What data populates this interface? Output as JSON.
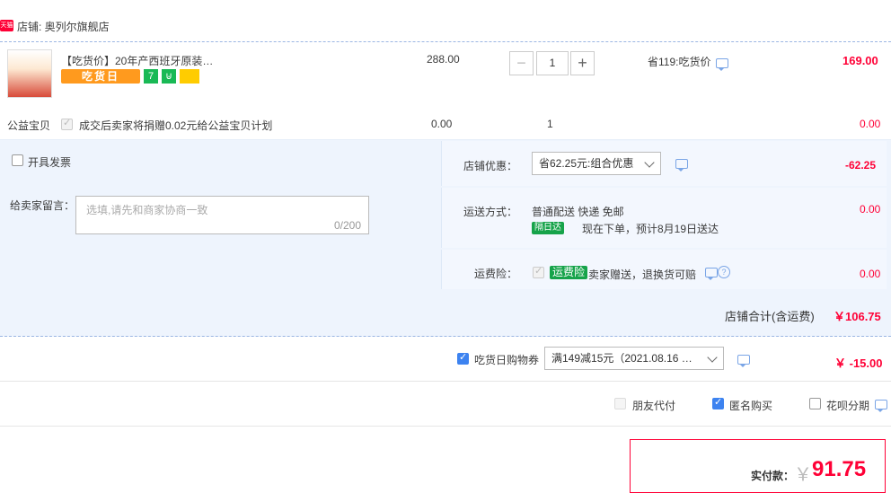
{
  "store": {
    "badge": "天猫",
    "label": "店铺: 奥列尔旗舰店"
  },
  "item": {
    "title": "【吃货价】20年产西班牙原装…",
    "tag_orange": "吃货日",
    "tag_green1": "7",
    "tag_green2": "⊍",
    "unit_price": "288.00",
    "qty_minus": "−",
    "quantity": "1",
    "qty_plus": "+",
    "promo": "省119:吃货价",
    "subtotal": "169.00"
  },
  "charity": {
    "label": "公益宝贝",
    "text": "成交后卖家将捐赠0.02元给公益宝贝计划",
    "price": "0.00",
    "qty": "1",
    "subtotal": "0.00"
  },
  "invoice": {
    "label": "开具发票"
  },
  "message": {
    "label": "给卖家留言：",
    "placeholder": "选填,请先和商家协商一致",
    "counter": "0/200"
  },
  "store_discount": {
    "label": "店铺优惠：",
    "selected": "省62.25元:组合优惠",
    "amount": "-62.25"
  },
  "shipping": {
    "label": "运送方式：",
    "method": "普通配送 快递 免邮",
    "badge": "隔日达",
    "eta": "现在下单，预计8月19日送达",
    "amount": "0.00"
  },
  "insurance": {
    "label": "运费险：",
    "badge": "运费险",
    "text": "卖家赠送，退换货可赔",
    "amount": "0.00"
  },
  "store_total": {
    "label": "店铺合计(含运费)",
    "amount": "￥106.75"
  },
  "coupon": {
    "label": "吃货日购物券",
    "selected": "满149减15元（2021.08.16 …",
    "amount": "￥ -15.00"
  },
  "options": {
    "friend_pay": "朋友代付",
    "anonymous": "匿名购买",
    "huabei": "花呗分期"
  },
  "payment": {
    "label": "实付款：",
    "currency": "￥",
    "amount": "91.75"
  },
  "colors": {
    "accent_red": "#ff0036",
    "accent_blue": "#3d83f0",
    "panel_bg": "#eef4fd"
  }
}
